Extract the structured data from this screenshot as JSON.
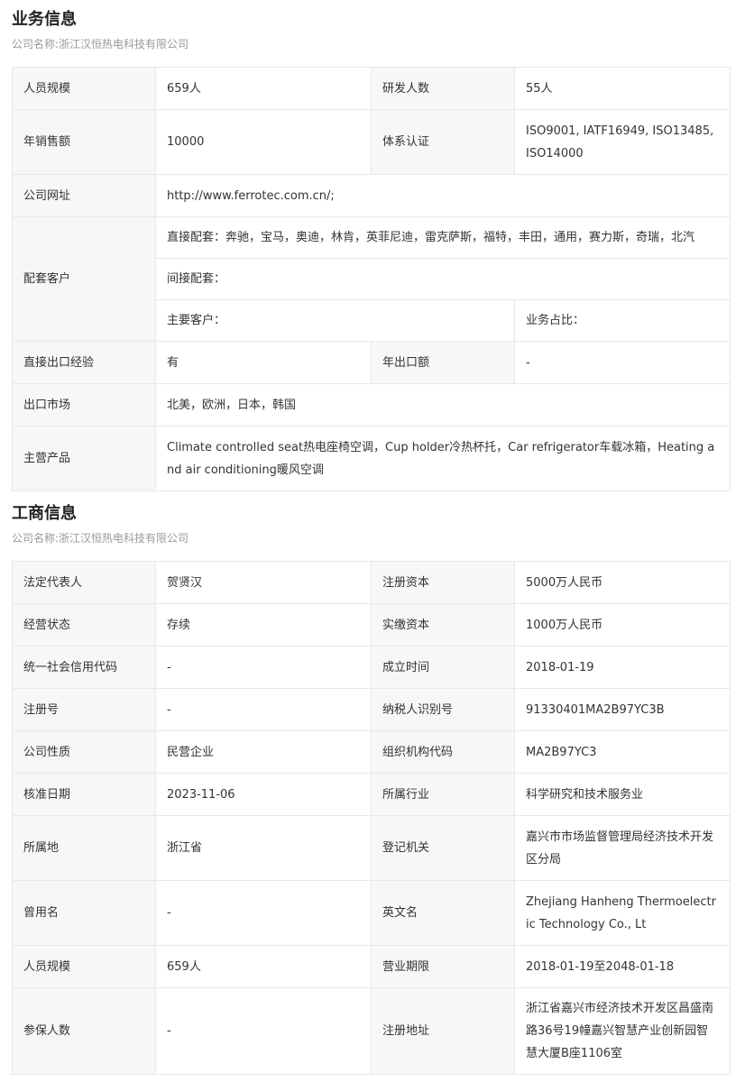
{
  "business": {
    "title": "业务信息",
    "company": "公司名称:浙江汉恒热电科技有限公司",
    "rows": {
      "staff_label": "人员规模",
      "staff_value": "659人",
      "rd_label": "研发人数",
      "rd_value": "55人",
      "sales_label": "年销售额",
      "sales_value": "10000",
      "cert_label": "体系认证",
      "cert_value": "ISO9001, IATF16949, ISO13485, ISO14000",
      "website_label": "公司网址",
      "website_value": "http://www.ferrotec.com.cn/;",
      "customers_label": "配套客户",
      "direct_label": "直接配套：",
      "direct_value": "奔驰，宝马，奥迪，林肯，英菲尼迪，雷克萨斯，福特，丰田，通用，赛力斯，奇瑞，北汽",
      "indirect_label": "间接配套：",
      "main_customer_label": "主要客户：",
      "share_label": "业务占比：",
      "export_exp_label": "直接出口经验",
      "export_exp_value": "有",
      "export_amount_label": "年出口额",
      "export_amount_value": "-",
      "export_market_label": "出口市场",
      "export_market_value": "北美，欧洲，日本，韩国",
      "products_label": "主营产品",
      "products_value": "Climate controlled seat热电座椅空调，Cup holder冷热杯托，Car refrigerator车载冰箱，Heating and air conditioning暖风空调"
    }
  },
  "commerce": {
    "title": "工商信息",
    "company": "公司名称:浙江汉恒热电科技有限公司",
    "rows": [
      {
        "l1": "法定代表人",
        "v1": "贺贤汉",
        "l2": "注册资本",
        "v2": "5000万人民币"
      },
      {
        "l1": "经营状态",
        "v1": "存续",
        "l2": "实缴资本",
        "v2": "1000万人民币"
      },
      {
        "l1": "统一社会信用代码",
        "v1": "-",
        "l2": "成立时间",
        "v2": "2018-01-19"
      },
      {
        "l1": "注册号",
        "v1": "-",
        "l2": "纳税人识别号",
        "v2": "91330401MA2B97YC3B"
      },
      {
        "l1": "公司性质",
        "v1": "民营企业",
        "l2": "组织机构代码",
        "v2": "MA2B97YC3"
      },
      {
        "l1": "核准日期",
        "v1": "2023-11-06",
        "l2": "所属行业",
        "v2": "科学研究和技术服务业"
      },
      {
        "l1": "所属地",
        "v1": "浙江省",
        "l2": "登记机关",
        "v2": "嘉兴市市场监督管理局经济技术开发区分局"
      },
      {
        "l1": "曾用名",
        "v1": "-",
        "l2": "英文名",
        "v2": "Zhejiang Hanheng Thermoelectric Technology Co., Lt"
      },
      {
        "l1": "人员规模",
        "v1": "659人",
        "l2": "营业期限",
        "v2": "2018-01-19至2048-01-18"
      },
      {
        "l1": "参保人数",
        "v1": "-",
        "l2": "注册地址",
        "v2": "浙江省嘉兴市经济技术开发区昌盛南路36号19幢嘉兴智慧产业创新园智慧大厦B座1106室"
      }
    ]
  }
}
